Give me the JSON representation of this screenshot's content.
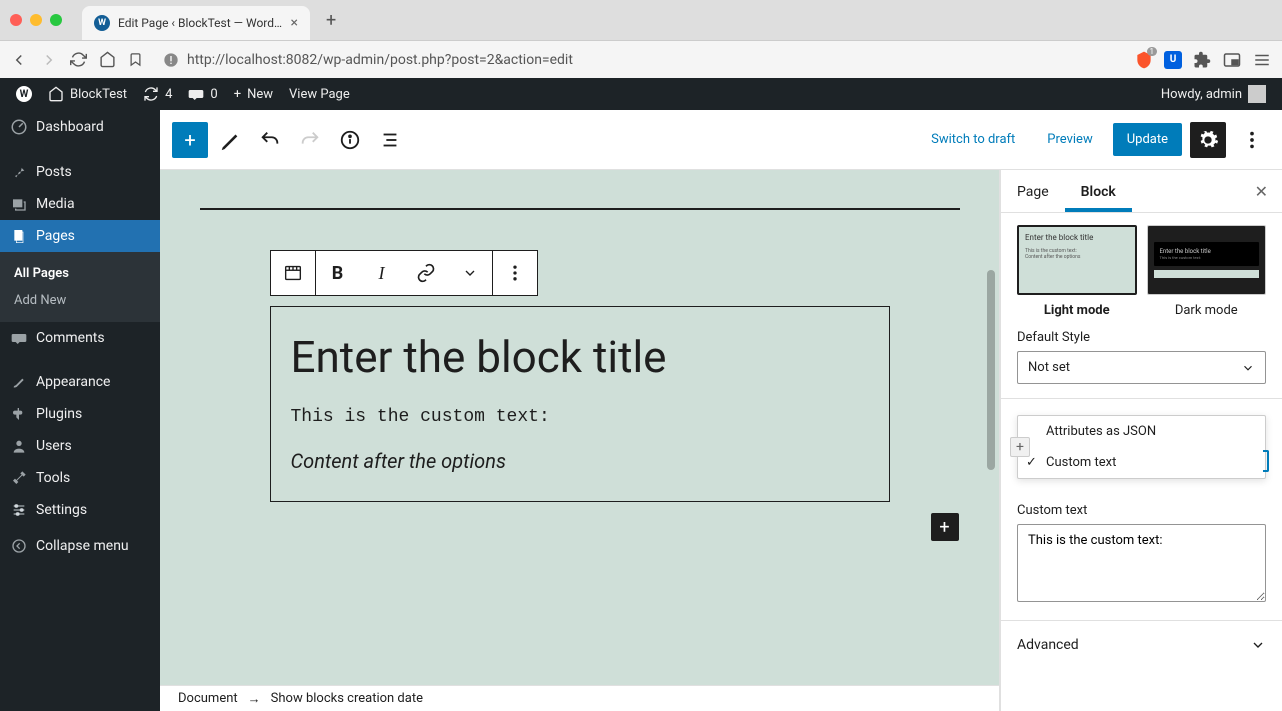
{
  "browser": {
    "tab_title": "Edit Page ‹ BlockTest — WordPr",
    "url": "http://localhost:8082/wp-admin/post.php?post=2&action=edit",
    "shield_count": "1"
  },
  "admin_bar": {
    "site_name": "BlockTest",
    "updates": "4",
    "comments": "0",
    "new": "New",
    "view_page": "View Page",
    "greeting": "Howdy, admin"
  },
  "sidebar": {
    "items": [
      {
        "label": "Dashboard"
      },
      {
        "label": "Posts"
      },
      {
        "label": "Media"
      },
      {
        "label": "Pages"
      },
      {
        "label": "Comments"
      },
      {
        "label": "Appearance"
      },
      {
        "label": "Plugins"
      },
      {
        "label": "Users"
      },
      {
        "label": "Tools"
      },
      {
        "label": "Settings"
      },
      {
        "label": "Collapse menu"
      }
    ],
    "submenu": {
      "all": "All Pages",
      "add": "Add New"
    }
  },
  "editor_header": {
    "switch_draft": "Switch to draft",
    "preview": "Preview",
    "update": "Update"
  },
  "block_toolbar": {},
  "block": {
    "title": "Enter the block title",
    "custom_text_display": "This is the custom text:",
    "after_text": "Content after the options"
  },
  "breadcrumb": {
    "root": "Document",
    "current": "Show blocks creation date"
  },
  "inspector": {
    "tabs": {
      "page": "Page",
      "block": "Block"
    },
    "styles": {
      "light": "Light mode",
      "dark": "Dark mode",
      "thumb_title": "Enter the block title",
      "thumb_sub1": "This is the custom text:",
      "thumb_sub2": "Content after the options"
    },
    "default_style_label": "Default Style",
    "default_style_value": "Not set",
    "popover": {
      "attributes": "Attributes as JSON",
      "custom_text": "Custom text"
    },
    "custom_text_label": "Custom text",
    "custom_text_value": "This is the custom text:",
    "advanced": "Advanced"
  }
}
